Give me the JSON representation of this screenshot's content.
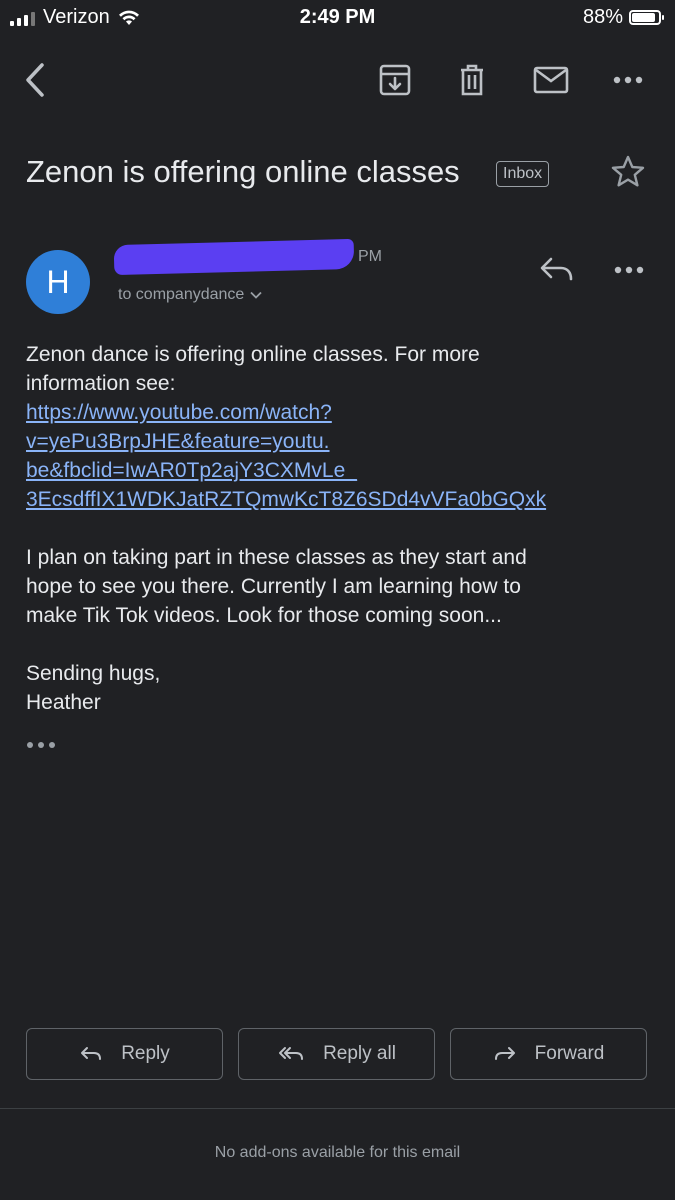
{
  "status_bar": {
    "carrier": "Verizon",
    "time": "2:49 PM",
    "battery_percent": "88%",
    "battery_level": 0.88
  },
  "toolbar": {
    "icons": [
      "back-icon",
      "archive-icon",
      "trash-icon",
      "mail-icon",
      "more-icon"
    ]
  },
  "email": {
    "subject": "Zenon is offering online classes",
    "label": "Inbox",
    "sender_initial": "H",
    "time_fragment": "PM",
    "recipient": "to companydance",
    "body": {
      "line1": "Zenon dance is offering online classes.  For more",
      "line2": "information see:",
      "link_lines": [
        "https://www.youtube.com/watch?",
        "v=yePu3BrpJHE&feature=youtu.",
        "be&fbclid=IwAR0Tp2ajY3CXMvLe_",
        "3EcsdffIX1WDKJatRZTQmwKcT8Z6SDd4vVFa0bGQxk"
      ],
      "para2": [
        "I plan on taking part in these classes as they start and",
        "hope to see you there.  Currently I am learning how to",
        "make Tik Tok videos. Look for those coming soon..."
      ],
      "signoff": "Sending hugs,",
      "signature": "Heather"
    }
  },
  "actions": {
    "reply": "Reply",
    "reply_all": "Reply all",
    "forward": "Forward"
  },
  "footer": "No add-ons available for this email",
  "colors": {
    "background": "#202124",
    "link": "#8ab4f8",
    "avatar": "#2f7fd8",
    "redaction": "#5b3ff2"
  }
}
